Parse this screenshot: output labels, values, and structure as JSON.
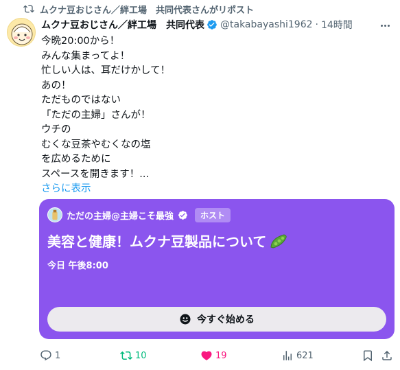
{
  "repost": {
    "text": "ムクナ豆おじさん／絆工場　共同代表さんがリポスト",
    "icon": "repost-icon"
  },
  "post": {
    "author_name": "ムクナ豆おじさん／絆工場　共同代表",
    "handle": "@takabayashi1962",
    "separator": "·",
    "time": "14時間",
    "lines": [
      "今晩20:00から！",
      "みんな集まってよ！",
      "忙しい人は、耳だけかして！",
      "あの！",
      "ただものではない",
      "「ただの主婦」さんが！",
      "ウチの",
      "むくな豆茶やむくなの塩",
      "を広めるために",
      "スペースを開きます！..."
    ],
    "show_more": "さらに表示"
  },
  "space_card": {
    "host_name": "ただの主婦@主婦こそ最強",
    "host_badge": "ホスト",
    "title": "美容と健康！ムクナ豆製品について",
    "title_emoji": "peapod-icon",
    "date": "今日 午後8:00",
    "start_button": "今すぐ始める",
    "accent_color": "#8b55ee"
  },
  "actions": {
    "replies": "1",
    "reposts": "10",
    "likes": "19",
    "views": "621",
    "repost_color": "#00ba7c",
    "like_color": "#f91880"
  },
  "colors": {
    "verified": "#1d9bf0",
    "link": "#1d9bf0"
  }
}
